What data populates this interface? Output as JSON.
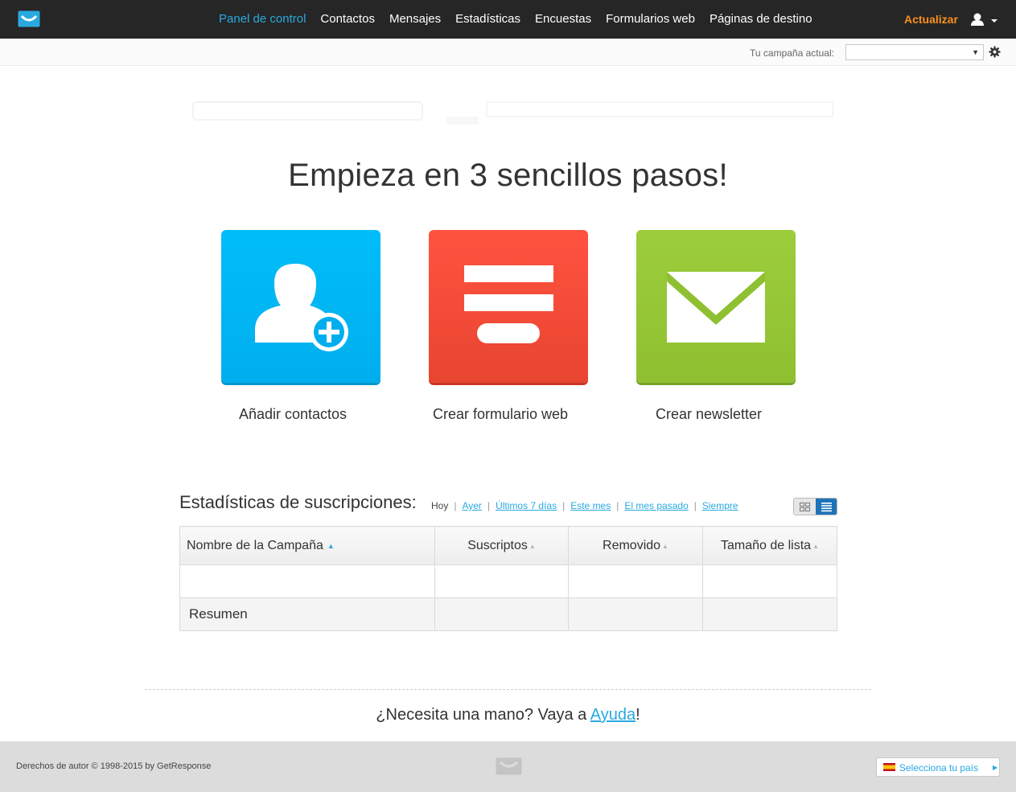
{
  "nav": {
    "items": [
      {
        "label": "Panel de control",
        "active": true
      },
      {
        "label": "Contactos"
      },
      {
        "label": "Mensajes"
      },
      {
        "label": "Estadísticas"
      },
      {
        "label": "Encuestas"
      },
      {
        "label": "Formularios web"
      },
      {
        "label": "Páginas de destino"
      }
    ],
    "upgrade_label": "Actualizar"
  },
  "campaign_bar": {
    "label": "Tu campaña actual:",
    "selected": ""
  },
  "hero": {
    "title": "Empieza en 3 sencillos pasos!",
    "steps": [
      {
        "label": "Añadir contactos",
        "icon": "add-contact-icon",
        "color": "#00b5f3"
      },
      {
        "label": "Crear formulario web",
        "icon": "web-form-icon",
        "color": "#f34c39"
      },
      {
        "label": "Crear newsletter",
        "icon": "envelope-icon",
        "color": "#96c735"
      }
    ]
  },
  "stats": {
    "title": "Estadísticas de suscripciones:",
    "periods": [
      "Hoy",
      "Ayer",
      "Últimos 7 días",
      "Este mes",
      "El mes pasado",
      "Siempre"
    ],
    "columns": [
      "Nombre de la Campaña",
      "Suscriptos",
      "Removido",
      "Tamaño de lista"
    ],
    "summary_label": "Resumen"
  },
  "help": {
    "prefix": "¿Necesita una mano? Vaya a ",
    "link": "Ayuda",
    "suffix": "!"
  },
  "footer": {
    "copyright": "Derechos de autor © 1998-2015 by GetResponse",
    "country_label": "Selecciona tu país"
  },
  "colors": {
    "accent": "#29a9e0",
    "upgrade": "#f7901e",
    "topbar": "#262626"
  }
}
